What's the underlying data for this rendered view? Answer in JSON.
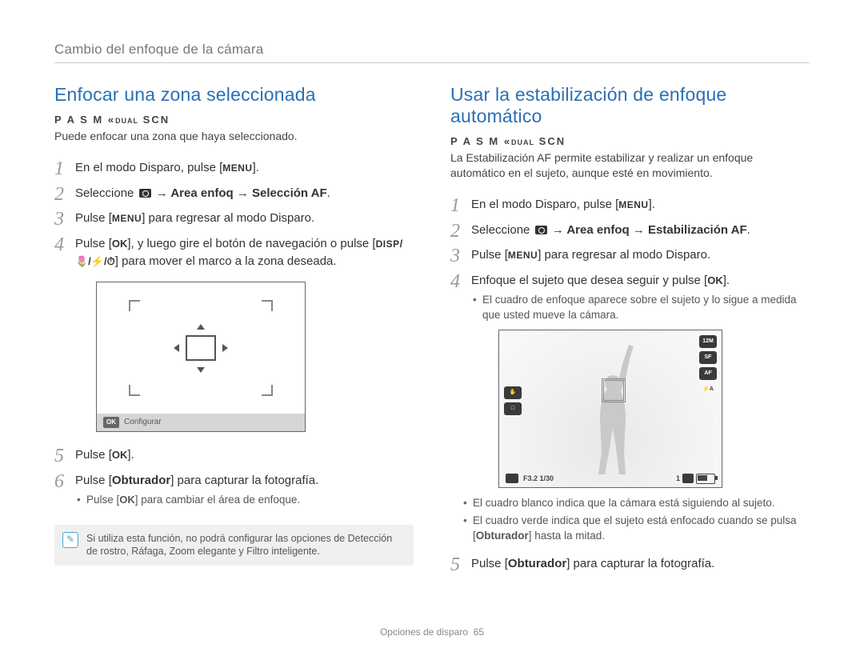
{
  "breadcrumb": "Cambio del enfoque de la cámara",
  "modes_line": "P A S M ",
  "modes_dual": "DUAL",
  "modes_scn": " SCN",
  "left": {
    "title": "Enfocar una zona seleccionada",
    "intro": "Puede enfocar una zona que haya seleccionado.",
    "step1_a": "En el modo Disparo, pulse [",
    "menu": "MENU",
    "step1_c": "].",
    "step2_a": "Seleccione ",
    "step2_b": " → Area enfoq → Selección AF",
    "step2_c": ".",
    "step3_a": "Pulse [",
    "step3_c": "] para regresar al modo Disparo.",
    "step4_a": "Pulse [",
    "ok": "OK",
    "step4_b": "], y luego gire el botón de navegación o pulse [",
    "disp_icons": "DISP/ / / ",
    "step4_c": "] para mover el marco a la zona deseada.",
    "vf_ok": "OK",
    "vf_footer": "Configurar",
    "step5_a": "Pulse [",
    "step5_c": "].",
    "step6_a": "Pulse [",
    "obturador": "Obturador",
    "step6_b": "] para capturar la fotografía.",
    "sub6_a": "Pulse [",
    "sub6_b": "] para cambiar el área de enfoque.",
    "note": "Si utiliza esta función, no podrá configurar las opciones de Detección de rostro, Ráfaga, Zoom elegante y Filtro inteligente."
  },
  "right": {
    "title": "Usar la estabilización de enfoque automático",
    "intro": "La Estabilización AF permite estabilizar y realizar un enfoque automático en el sujeto, aunque esté en movimiento.",
    "step1_a": "En el modo Disparo, pulse [",
    "step1_c": "].",
    "step2_a": "Seleccione ",
    "step2_b": " → Area enfoq → Estabilización AF",
    "step2_c": ".",
    "step3_a": "Pulse [",
    "step3_c": "] para regresar al modo Disparo.",
    "step4_a": "Enfoque el sujeto que desea seguir y pulse [",
    "step4_c": "].",
    "sub4": "El cuadro de enfoque aparece sobre el sujeto y lo sigue a medida que usted mueve la cámara.",
    "osd": {
      "res": "12M",
      "fmt": "SF",
      "af": "AF",
      "flash": "⚡A",
      "hand": "✋",
      "coord": "□",
      "exposure": "F3.2 1/30",
      "count": "1",
      "sd": "SD"
    },
    "sub_a": "El cuadro blanco indica que la cámara está siguiendo al sujeto.",
    "sub_b_1": "El cuadro verde indica que el sujeto está enfocado cuando se pulsa [",
    "sub_b_2": "] hasta la mitad.",
    "step5_a": "Pulse [",
    "step5_b": "] para capturar la fotografía."
  },
  "footer_a": "Opciones de disparo",
  "footer_b": "65"
}
